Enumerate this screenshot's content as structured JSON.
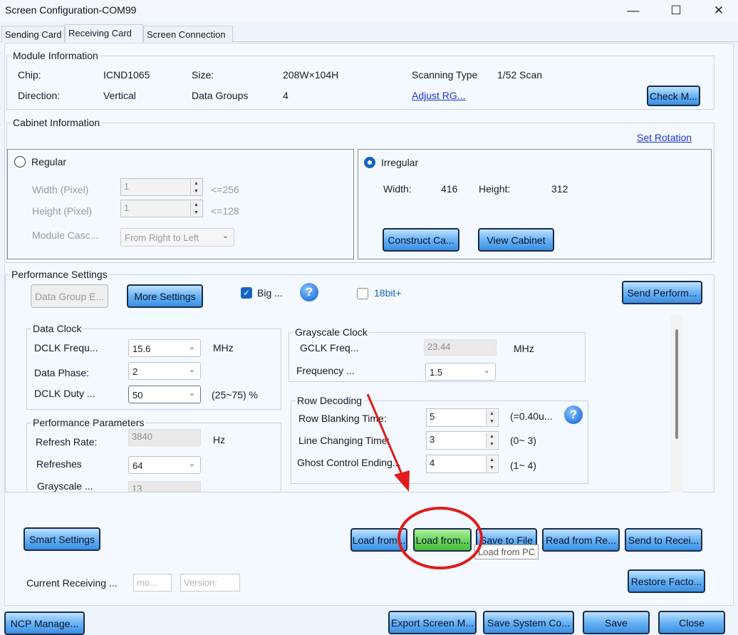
{
  "window": {
    "title": "Screen Configuration-COM99"
  },
  "tabs": [
    "Sending Card",
    "Receiving Card",
    "Screen Connection"
  ],
  "module": {
    "legend": "Module Information",
    "chip_label": "Chip:",
    "chip_value": "ICND1065",
    "size_label": "Size:",
    "size_value": "208W×104H",
    "scan_label": "Scanning Type",
    "scan_value": "1/52 Scan",
    "direction_label": "Direction:",
    "direction_value": "Vertical",
    "groups_label": "Data Groups",
    "groups_value": "4",
    "adjust_link": "Adjust RG...",
    "check_button": "Check M..."
  },
  "cabinet": {
    "legend": "Cabinet Information",
    "set_rotation": "Set Rotation",
    "regular": {
      "label": "Regular",
      "width_label": "Width (Pixel)",
      "width_value": "1",
      "width_hint": "<=256",
      "height_label": "Height (Pixel)",
      "height_value": "1",
      "height_hint": "<=128",
      "cascade_label": "Module Casc...",
      "cascade_value": "From Right to Left"
    },
    "irregular": {
      "label": "Irregular",
      "width_label": "Width:",
      "width_value": "416",
      "height_label": "Height:",
      "height_value": "312",
      "construct_button": "Construct Ca...",
      "view_button": "View Cabinet"
    }
  },
  "performance": {
    "legend": "Performance Settings",
    "data_group_button": "Data Group E...",
    "more_settings_button": "More Settings",
    "big_label": "Big ...",
    "bit18_label": "18bit+",
    "send_button": "Send Perform...",
    "data_clock": {
      "legend": "Data Clock",
      "dclk_freq_label": "DCLK Frequ...",
      "dclk_freq_value": "15.6",
      "dclk_freq_unit": "MHz",
      "phase_label": "Data Phase:",
      "phase_value": "2",
      "duty_label": "DCLK Duty ...",
      "duty_value": "50",
      "duty_hint": "(25~75) %"
    },
    "grayscale_clock": {
      "legend": "Grayscale Clock",
      "gclk_label": "GCLK Freq...",
      "gclk_value": "23.44",
      "gclk_unit": "MHz",
      "frequency_label": "Frequency ...",
      "frequency_value": "1.5"
    },
    "row_decoding": {
      "legend": "Row Decoding",
      "blanking_label": "Row Blanking Time:",
      "blanking_value": "5",
      "blanking_hint": "(=0.40u...",
      "line_label": "Line Changing Time:",
      "line_value": "3",
      "line_hint": "(0~ 3)",
      "ghost_label": "Ghost Control Ending...",
      "ghost_value": "4",
      "ghost_hint": "(1~ 4)"
    },
    "params": {
      "legend": "Performance Parameters",
      "refresh_label": "Refresh Rate:",
      "refresh_value": "3840",
      "refresh_unit": "Hz",
      "refreshes_label": "Refreshes",
      "refreshes_value": "64",
      "grayscale_label": "Grayscale ...",
      "grayscale_value": "13"
    }
  },
  "actions": {
    "smart_settings": "Smart Settings",
    "load_from_1": "Load from...",
    "load_from_2": "Load from...",
    "save_to_file": "Save to File",
    "read_from": "Read from Re...",
    "send_to": "Send to Recei...",
    "tooltip": "Load from PC",
    "current_label": "Current Receiving ...",
    "model_placeholder": "mo...",
    "version_placeholder": "Version:",
    "restore": "Restore Facto..."
  },
  "footer": {
    "ncp": "NCP Manage...",
    "export": "Export Screen M...",
    "save_system": "Save System Co...",
    "save": "Save",
    "close": "Close"
  },
  "colors": {
    "accent": "#1565c0",
    "annotation": "#e01c1c",
    "button_green": "#6ed65e"
  }
}
